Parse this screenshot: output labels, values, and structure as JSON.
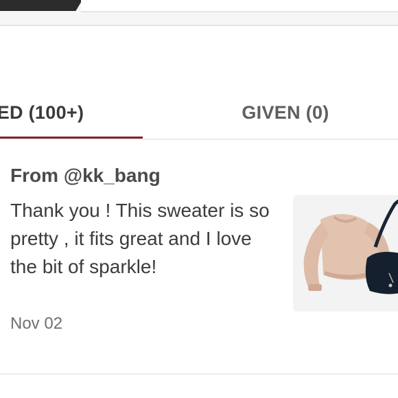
{
  "tabs": {
    "received_label": "ED (100+)",
    "given_label": "GIVEN (0)"
  },
  "comment": {
    "from": "From @kk_bang",
    "message": "Thank you ! This sweater is so pretty , it fits great and I love the bit of sparkle!",
    "date": "Nov 02",
    "thumbnail_icon": "sweater-and-bag-photo"
  },
  "colors": {
    "active_tab_underline": "#7f1f2b"
  }
}
